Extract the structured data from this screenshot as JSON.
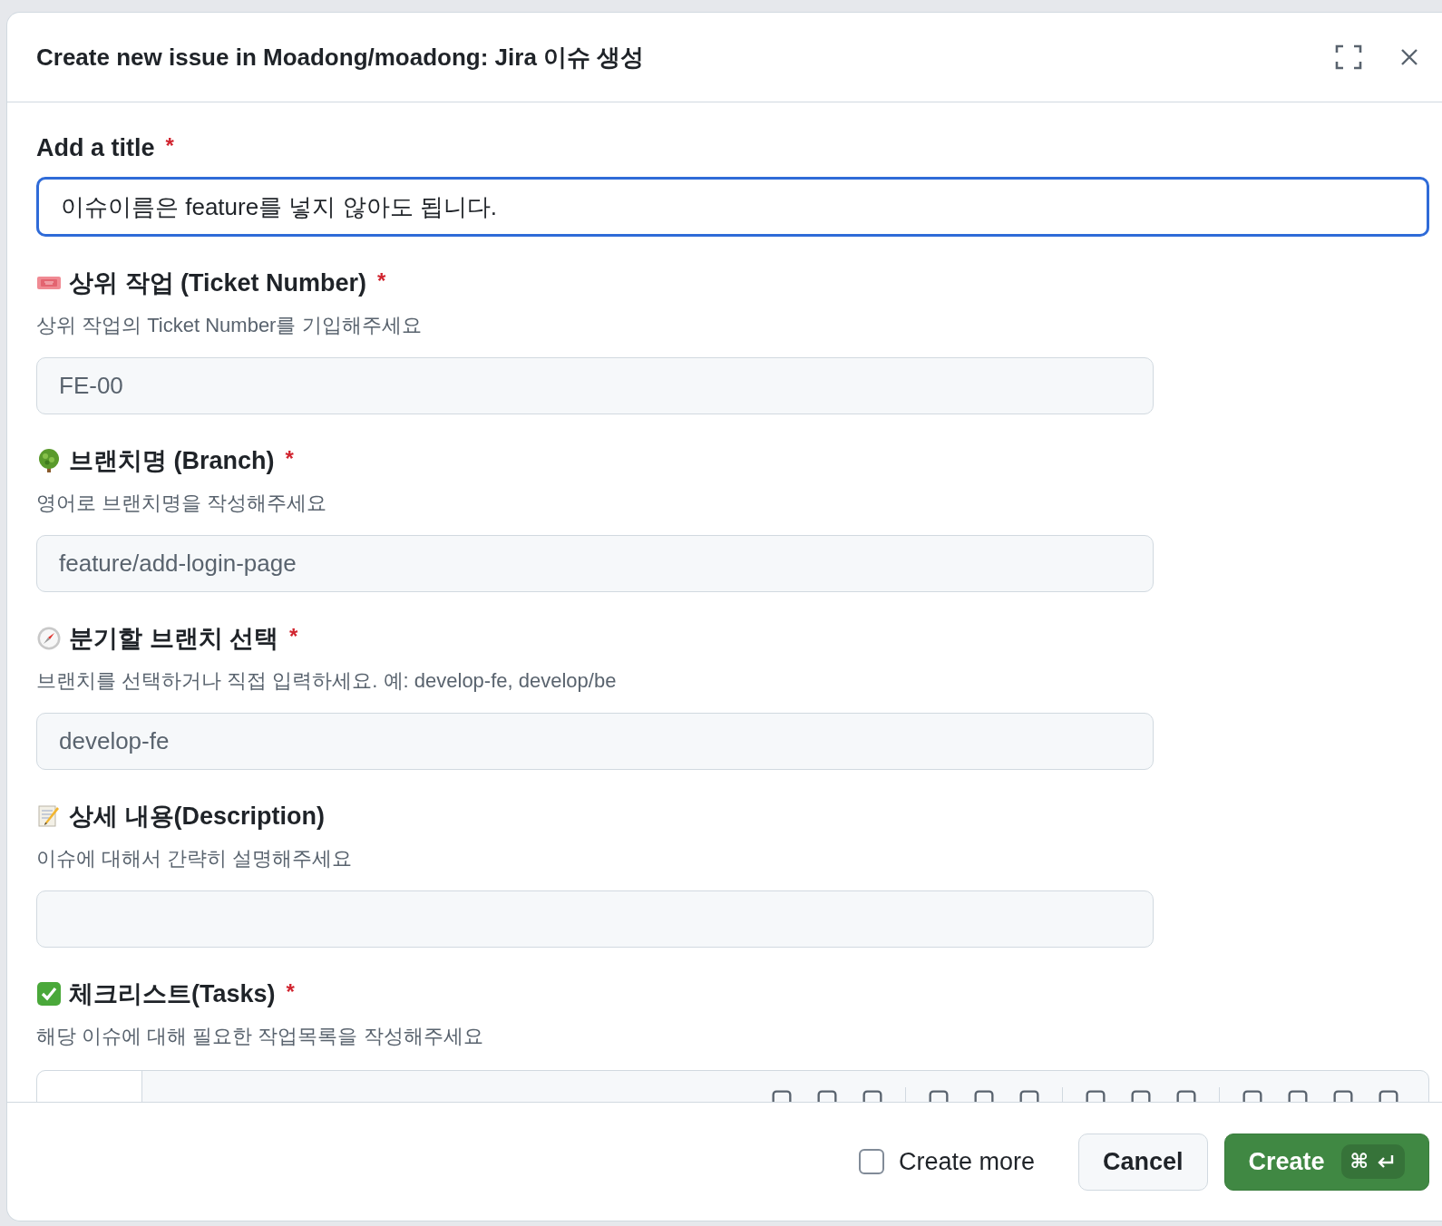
{
  "dialog": {
    "title": "Create new issue in Moadong/moadong: Jira 이슈 생성",
    "fields": [
      {
        "kind": "title",
        "label": "Add a title",
        "required_mark": "*",
        "value": "이슈이름은 feature를 넣지 않아도 됩니다.",
        "focused": true
      },
      {
        "kind": "input",
        "label": "상위 작업 (Ticket Number)",
        "required_mark": "*",
        "description": "상위 작업의 Ticket Number를 기입해주세요",
        "placeholder": "FE-00",
        "focused": false
      },
      {
        "kind": "input",
        "label": "브랜치명 (Branch)",
        "required_mark": "*",
        "description": "영어로 브랜치명을 작성해주세요",
        "placeholder": "feature/add-login-page",
        "focused": false
      },
      {
        "kind": "input",
        "label": "분기할 브랜치 선택",
        "required_mark": "*",
        "description": "브랜치를 선택하거나 직접 입력하세요. 예: develop-fe, develop/be",
        "placeholder": "develop-fe",
        "focused": false
      },
      {
        "kind": "input",
        "label": "상세 내용(Description)",
        "description": "이슈에 대해서 간략히 설명해주세요",
        "focused": false
      },
      {
        "kind": "markdown",
        "label": "체크리스트(Tasks)",
        "required_mark": "*",
        "description": "해당 이슈에 대해 필요한 작업목록을 작성해주세요"
      }
    ],
    "footer": {
      "create_more": {
        "label": "Create more",
        "checked": false
      },
      "cancel": "Cancel",
      "create": {
        "label": "Create",
        "shortcut": "⌘"
      }
    }
  }
}
